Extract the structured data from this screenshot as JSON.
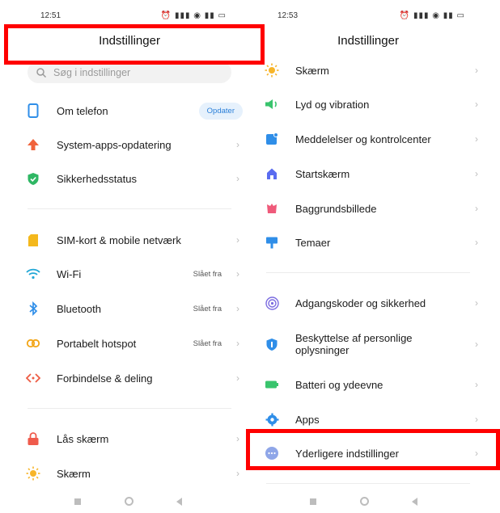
{
  "left": {
    "status_time": "12:51",
    "status_icons": "⚐ ⚑ ⬤ ⋯",
    "status_right": "⏰ ▮▮▮ ◉ ▮▮ ▭",
    "title": "Indstillinger",
    "search_placeholder": "Søg i indstillinger",
    "rows": [
      {
        "label": "Om telefon",
        "badge": "Opdater"
      },
      {
        "label": "System-apps-opdatering"
      },
      {
        "label": "Sikkerhedsstatus"
      },
      {
        "label": "SIM-kort & mobile netværk"
      },
      {
        "label": "Wi-Fi",
        "value": "Slået fra"
      },
      {
        "label": "Bluetooth",
        "value": "Slået fra"
      },
      {
        "label": "Portabelt hotspot",
        "value": "Slået fra"
      },
      {
        "label": "Forbindelse & deling"
      },
      {
        "label": "Lås skærm"
      },
      {
        "label": "Skærm"
      }
    ]
  },
  "right": {
    "status_time": "12:53",
    "status_icons": "⚐ ⚑ ⬤ ⋯",
    "status_right": "⏰ ▮▮▮ ◉ ▮▮ ▭",
    "title": "Indstillinger",
    "rows": [
      {
        "label": "Skærm"
      },
      {
        "label": "Lyd og vibration"
      },
      {
        "label": "Meddelelser og kontrolcenter"
      },
      {
        "label": "Startskærm"
      },
      {
        "label": "Baggrundsbillede"
      },
      {
        "label": "Temaer"
      },
      {
        "label": "Adgangskoder og sikkerhed"
      },
      {
        "label": "Beskyttelse af personlige oplysninger"
      },
      {
        "label": "Batteri og ydeevne"
      },
      {
        "label": "Apps"
      },
      {
        "label": "Yderligere indstillinger"
      }
    ]
  },
  "chevron": "›",
  "colors": {
    "highlight": "#ff0000",
    "badge_text": "#2a7fd8",
    "badge_bg": "#e6f1fc"
  }
}
